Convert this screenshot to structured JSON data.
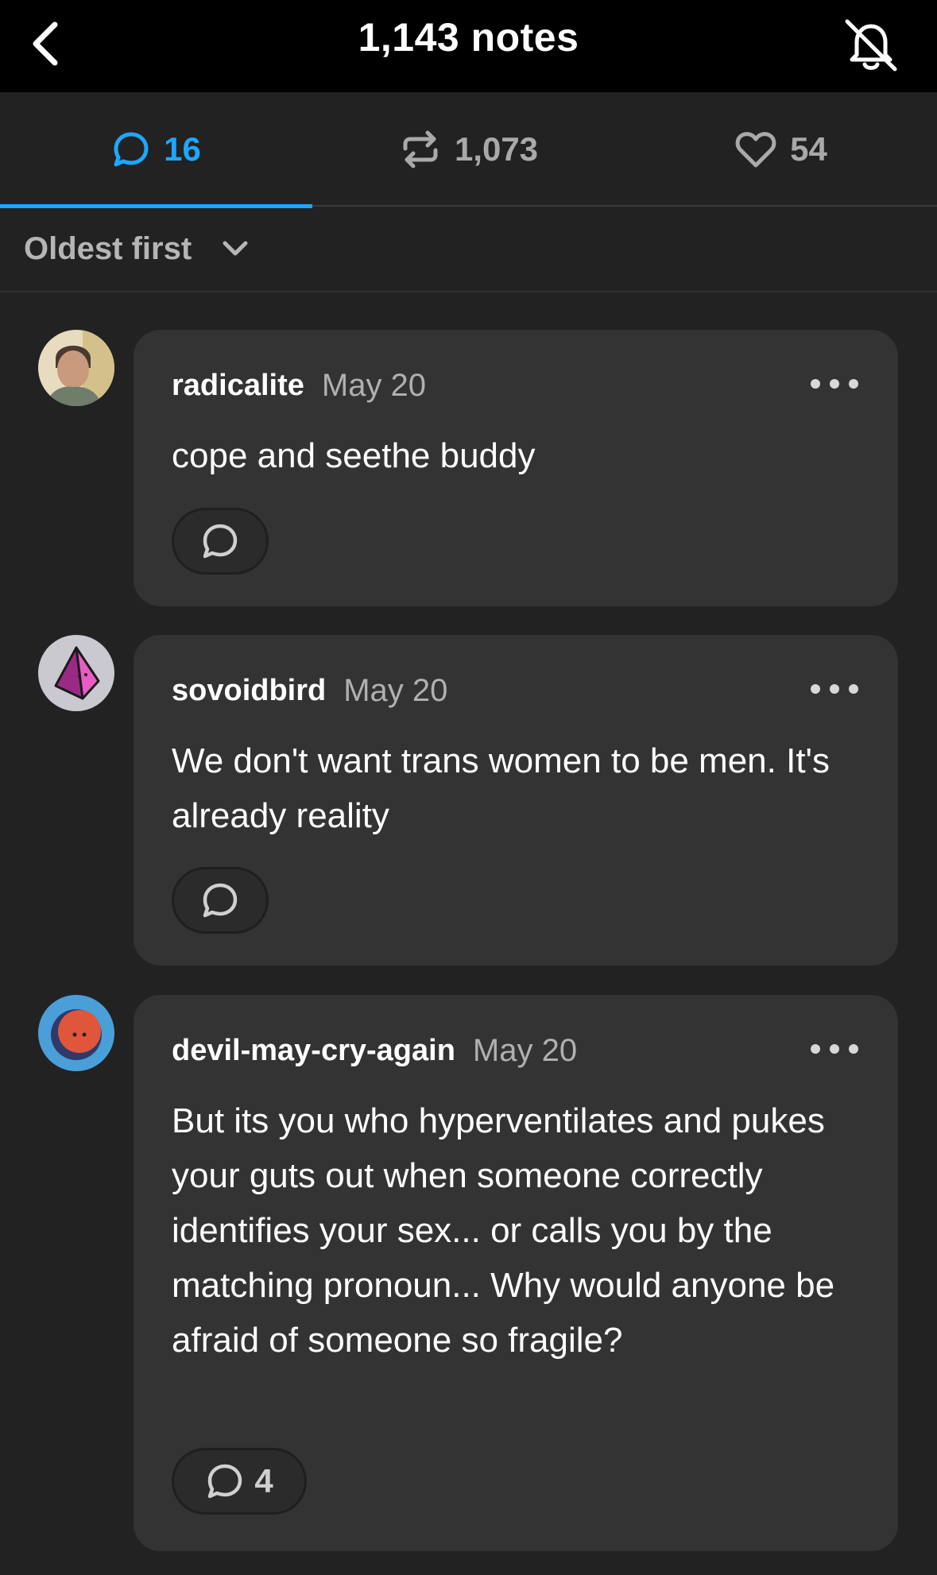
{
  "header": {
    "title": "1,143 notes",
    "back_icon": "chevron-left-icon",
    "bell_icon": "bell-off-icon"
  },
  "tabs": [
    {
      "icon": "comment-icon",
      "count": "16",
      "active": true
    },
    {
      "icon": "reblog-icon",
      "count": "1,073",
      "active": false
    },
    {
      "icon": "heart-icon",
      "count": "54",
      "active": false
    }
  ],
  "sort": {
    "label": "Oldest first",
    "icon": "chevron-down-icon"
  },
  "notes": [
    {
      "username": "radicalite",
      "date": "May 20",
      "text": "cope and seethe buddy",
      "reply_count": ""
    },
    {
      "username": "sovoidbird",
      "date": "May 20",
      "text": "We don't want trans women to be men. It's already reality",
      "reply_count": ""
    },
    {
      "username": "devil-may-cry-again",
      "date": "May 20",
      "text": "But its you who hyperventilates and pukes your guts out when someone correctly identifies your sex... or calls you by the matching pronoun... Why would anyone be afraid of someone so fragile?",
      "reply_count": "4"
    }
  ],
  "colors": {
    "accent": "#1ea7ff",
    "background": "#222222",
    "card": "#333333"
  }
}
